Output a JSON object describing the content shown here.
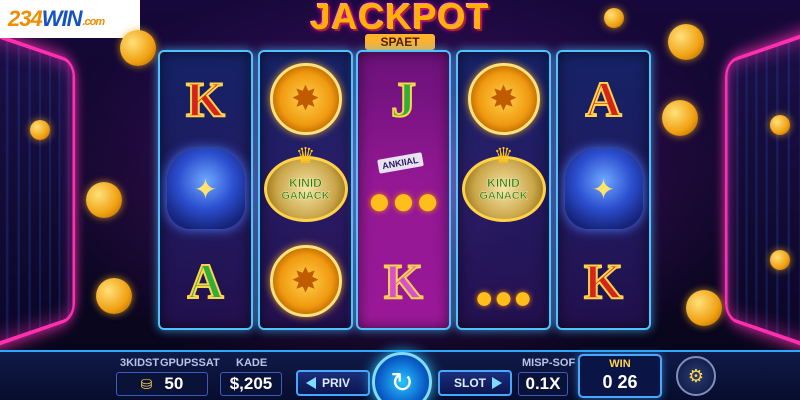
{
  "logo": {
    "num": "234",
    "brand": "WIN",
    "tld": ".com"
  },
  "header": {
    "title": "JACKPOT",
    "subtitle": "SPAET"
  },
  "reels": {
    "r1": {
      "top": "K",
      "bottom": "A"
    },
    "r2": {},
    "r3": {
      "top": "J",
      "sign": "ANKIIAL",
      "bottom": "K"
    },
    "r4": {},
    "r5": {
      "top": "A",
      "bottom": "K"
    },
    "badge_line1": "KINID",
    "badge_line2": "GANACK"
  },
  "bottom": {
    "label_left": "3KIDST",
    "label_bet": "GPUPSSAT",
    "bet_value": "50",
    "label_balance": "KADE",
    "balance_value": "$,205",
    "prev_label": "PRIV",
    "next_label": "SLOT",
    "label_mult": "MISP-SOF",
    "mult_value": "0.1X",
    "win_label": "WIN",
    "win_value": "0 26"
  },
  "colors": {
    "accent": "#ff2fb0",
    "neon_blue": "#4ec3ff",
    "gold": "#ffb200"
  }
}
